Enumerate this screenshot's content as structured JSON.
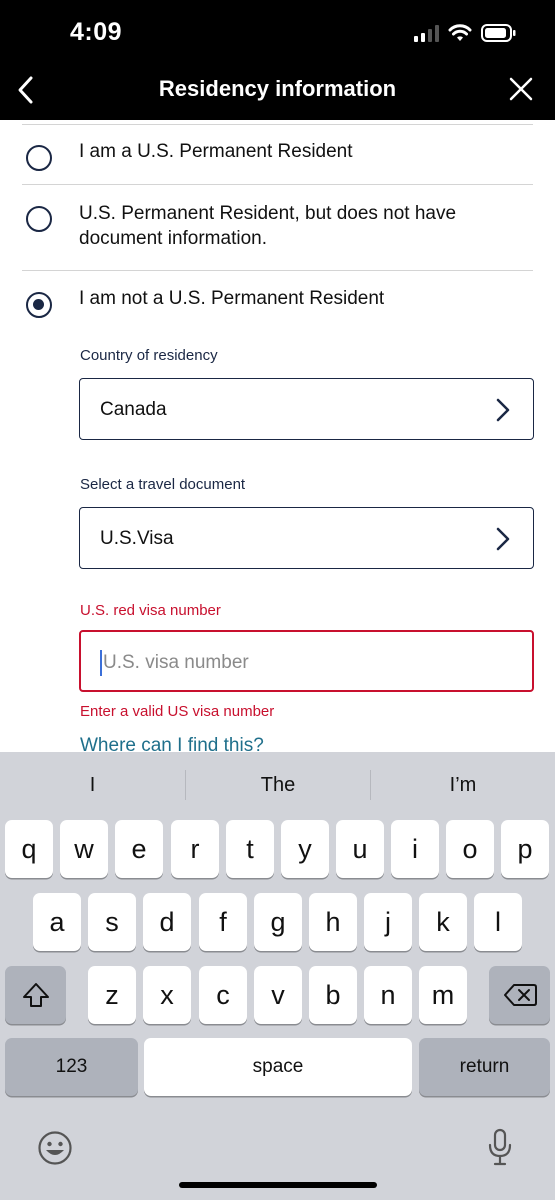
{
  "status_bar": {
    "time": "4:09",
    "icons": [
      "cellular-signal-icon",
      "wifi-icon",
      "battery-icon"
    ]
  },
  "nav": {
    "title": "Residency information",
    "back_icon": "chevron-left-icon",
    "close_icon": "close-icon"
  },
  "residency_options": [
    {
      "label": "I am a U.S. Permanent Resident",
      "selected": false
    },
    {
      "label": "U.S. Permanent Resident, but does not have document information.",
      "selected": false
    },
    {
      "label": "I am not a U.S. Permanent Resident",
      "selected": true
    }
  ],
  "country": {
    "label": "Country of residency",
    "value": "Canada"
  },
  "travel_document": {
    "label": "Select a travel document",
    "value": "U.S.Visa"
  },
  "visa_number": {
    "label": "U.S. red visa number",
    "placeholder": "U.S. visa number",
    "error": "Enter a valid US visa number"
  },
  "help_link": "Where can I find this?",
  "keyboard": {
    "suggestions": [
      "I",
      "The",
      "I’m"
    ],
    "row1": [
      "q",
      "w",
      "e",
      "r",
      "t",
      "y",
      "u",
      "i",
      "o",
      "p"
    ],
    "row2": [
      "a",
      "s",
      "d",
      "f",
      "g",
      "h",
      "j",
      "k",
      "l"
    ],
    "row3": [
      "z",
      "x",
      "c",
      "v",
      "b",
      "n",
      "m"
    ],
    "numbers_key": "123",
    "space_key": "space",
    "return_key": "return",
    "icons": [
      "shift-icon",
      "backspace-icon",
      "emoji-icon",
      "microphone-icon"
    ]
  },
  "colors": {
    "accent_navy": "#1a2744",
    "error_red": "#c8102e",
    "link_teal": "#1f6f8b"
  }
}
